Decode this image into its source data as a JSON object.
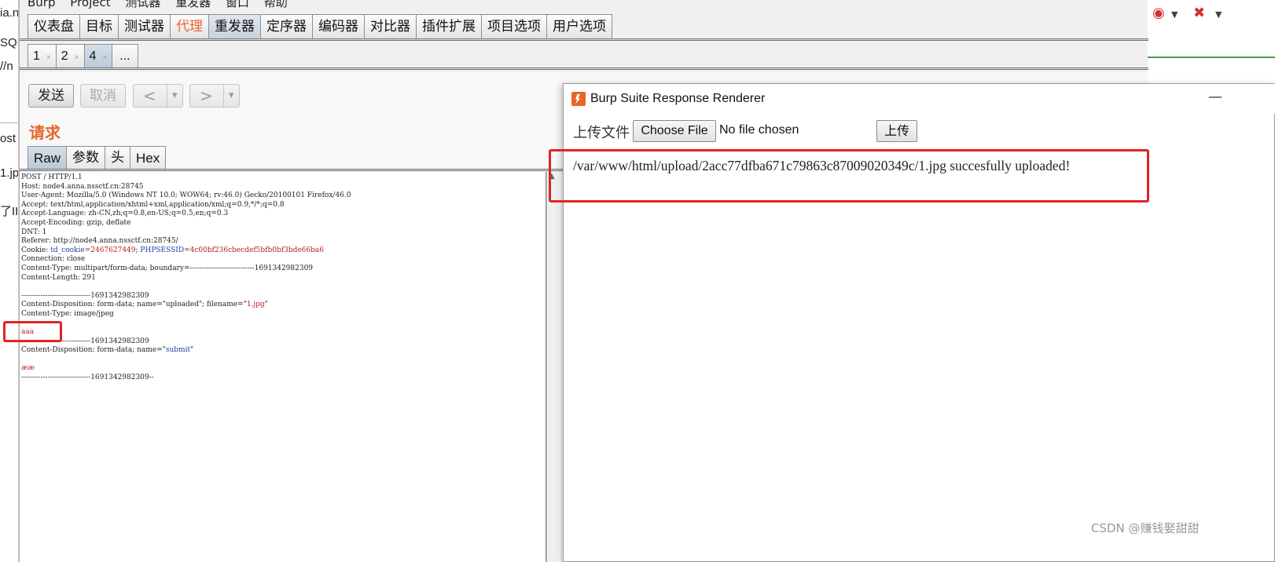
{
  "background_browser": {
    "left_fragments": [
      "ia.n",
      "SQL",
      "//n",
      "ost",
      "1.jp",
      "了II"
    ],
    "toolbar_icons": [
      "eye-shield-icon",
      "chevron-down-icon",
      "noscript-icon",
      "chevron-down-icon"
    ]
  },
  "burp": {
    "menu": [
      "Burp",
      "Project",
      "测试器",
      "重发器",
      "窗口",
      "帮助"
    ],
    "main_tabs": [
      "仪表盘",
      "目标",
      "测试器",
      "代理",
      "重发器",
      "定序器",
      "编码器",
      "对比器",
      "插件扩展",
      "项目选项",
      "用户选项"
    ],
    "active_main_tab": "代理",
    "selected_main_tab": "重发器",
    "sub_tabs": [
      {
        "label": "1",
        "close": "×"
      },
      {
        "label": "2",
        "close": "×"
      },
      {
        "label": "4",
        "close": "×"
      }
    ],
    "sub_tab_more": "...",
    "buttons": {
      "send": "发送",
      "cancel": "取消",
      "back": "<",
      "forward": ">",
      "dropdown": "▾"
    },
    "request_title": "请求",
    "request_tabs": [
      "Raw",
      "参数",
      "头",
      "Hex"
    ],
    "request_lines": [
      [
        {
          "t": "POST / HTTP/1.1"
        }
      ],
      [
        {
          "t": "Host: node4.anna.nssctf.cn:28745"
        }
      ],
      [
        {
          "t": "User-Agent: Mozilla/5.0 (Windows NT 10.0; WOW64; rv:46.0) Gecko/20100101 Firefox/46.0"
        }
      ],
      [
        {
          "t": "Accept: text/html,application/xhtml+xml,application/xml;q=0.9,*/*;q=0.8"
        }
      ],
      [
        {
          "t": "Accept-Language: zh-CN,zh;q=0.8,en-US;q=0.5,en;q=0.3"
        }
      ],
      [
        {
          "t": "Accept-Encoding: gzip, deflate"
        }
      ],
      [
        {
          "t": "DNT: 1"
        }
      ],
      [
        {
          "t": "Referer: http://node4.anna.nssctf.cn:28745/"
        }
      ],
      [
        {
          "t": "Cookie: "
        },
        {
          "t": "td_cookie",
          "c": "blue"
        },
        {
          "t": "=2467627449",
          "c": "red"
        },
        {
          "t": "; "
        },
        {
          "t": "PHPSESSID",
          "c": "blue"
        },
        {
          "t": "=4c00bf236cbecdef5bfb0bf3bde66ba6",
          "c": "red"
        }
      ],
      [
        {
          "t": "Connection: close"
        }
      ],
      [
        {
          "t": "Content-Type: multipart/form-data; boundary=---------------------------1691342982309"
        }
      ],
      [
        {
          "t": "Content-Length: 291"
        }
      ],
      [
        {
          "t": ""
        }
      ],
      [
        {
          "t": "-----------------------------1691342982309"
        }
      ],
      [
        {
          "t": "Content-Disposition: form-data; name=\"uploaded\"; filename=\""
        },
        {
          "t": "1.jpg",
          "c": "red"
        },
        {
          "t": "\""
        }
      ],
      [
        {
          "t": "Content-Type: image/jpeg"
        }
      ],
      [
        {
          "t": ""
        }
      ],
      [
        {
          "t": "aaa",
          "c": "red"
        }
      ],
      [
        {
          "t": "-----------------------------1691342982309"
        }
      ],
      [
        {
          "t": "Content-Disposition: form-data; name=\""
        },
        {
          "t": "submit",
          "c": "blue"
        },
        {
          "t": "\""
        }
      ],
      [
        {
          "t": ""
        }
      ],
      [
        {
          "t": "ææ",
          "c": "red"
        }
      ],
      [
        {
          "t": "-----------------------------1691342982309--"
        }
      ]
    ]
  },
  "renderer": {
    "title": "Burp Suite Response Renderer",
    "minimize": "—",
    "upload_label": "上传文件",
    "choose_file": "Choose File",
    "no_file": "No file chosen",
    "upload_button": "上传",
    "result": "/var/www/html/upload/2acc77dfba671c79863c87009020349c/1.jpg succesfully uploaded!"
  },
  "watermark": "CSDN @赚钱娶甜甜",
  "colors": {
    "accent": "#e8652c",
    "highlight_box": "#e02424",
    "key_blue": "#1a3fa8",
    "value_red": "#b81c1c"
  }
}
